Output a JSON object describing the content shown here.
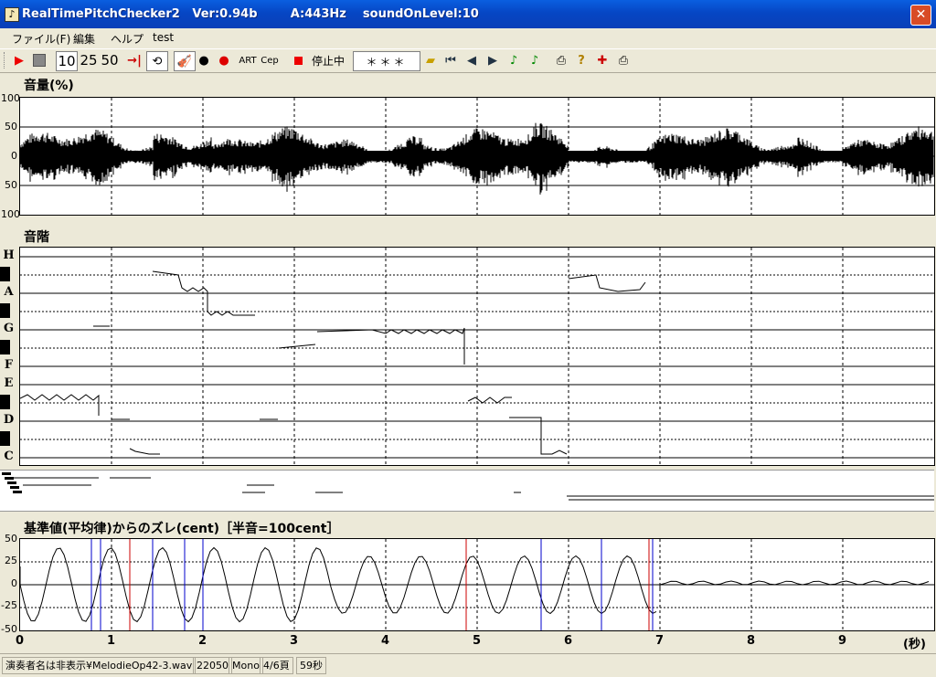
{
  "window": {
    "title": "RealTimePitchChecker2   Ver:0.94b        A:443Hz    soundOnLevel:10"
  },
  "menu": [
    "ファイル(F)",
    "編集",
    "ヘルプ",
    "test"
  ],
  "toolbar": {
    "speed_options": [
      "10",
      "25",
      "50"
    ],
    "art_label": "ART",
    "cep_label": "Cep",
    "status_label": "停止中",
    "note_display": "＊＊＊"
  },
  "volume_panel": {
    "label": "音量(%)",
    "y_ticks": [
      "100",
      "50",
      "0",
      "50",
      "100"
    ]
  },
  "scale_panel": {
    "label": "音階",
    "notes": [
      "H",
      "A",
      "G",
      "F",
      "E",
      "D",
      "C"
    ]
  },
  "deviation_panel": {
    "label": "基準値(平均律)からのズレ(cent)［半音=100cent］",
    "y_ticks": [
      "50",
      "25",
      "0",
      "-25",
      "-50"
    ]
  },
  "x_axis": {
    "ticks": [
      "0",
      "1",
      "2",
      "3",
      "4",
      "5",
      "6",
      "7",
      "8",
      "9"
    ],
    "unit": "(秒)"
  },
  "statusbar": {
    "file": "演奏者名は非表示¥MelodieOp42-3.wav",
    "rate": "22050",
    "channels": "Mono",
    "page": "4/6頁",
    "duration": "59秒"
  }
}
